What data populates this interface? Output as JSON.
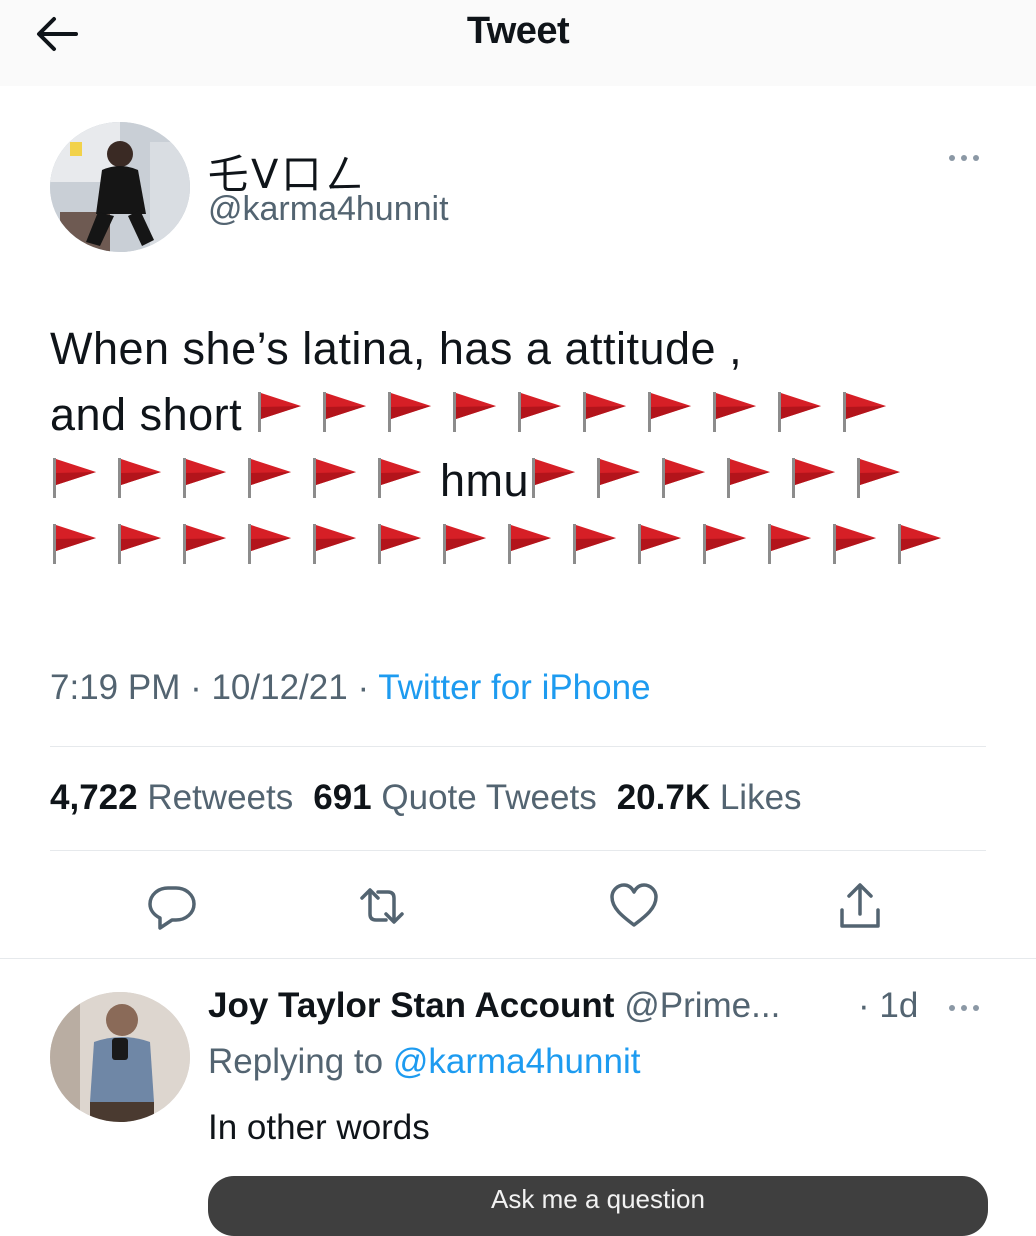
{
  "header": {
    "title": "Tweet",
    "back_icon": "arrow-left-icon"
  },
  "tweet": {
    "author": {
      "display_name": "乇V口ㄥ",
      "handle": "@karma4hunnit"
    },
    "text": {
      "line1": "When she’s latina, has a attitude ,",
      "line2_prefix": "and short",
      "line3_word": "hmu",
      "flag_emoji": "🚩",
      "flag_counts": {
        "line2": 10,
        "line3_before": 6,
        "line3_after": 6,
        "line4": 14
      }
    },
    "meta": {
      "time": "7:19 PM",
      "separator": " · ",
      "date": "10/12/21",
      "source": "Twitter for iPhone"
    },
    "stats": {
      "retweets_count": "4,722",
      "retweets_label": "Retweets",
      "quotes_count": "691",
      "quotes_label": "Quote Tweets",
      "likes_count": "20.7K",
      "likes_label": "Likes"
    },
    "actions": [
      "reply-icon",
      "retweet-icon",
      "like-icon",
      "share-icon"
    ]
  },
  "reply": {
    "name": "Joy Taylor Stan Account",
    "handle": "@Prime...",
    "time": "· 1d",
    "replying_prefix": "Replying to",
    "replying_to": "@karma4hunnit",
    "text": "In other words",
    "card_text": "Ask me a question"
  },
  "colors": {
    "link": "#1d9bf0",
    "secondary_text": "#536471",
    "flag_red": "#d61f26",
    "divider": "#e6e9ec"
  }
}
